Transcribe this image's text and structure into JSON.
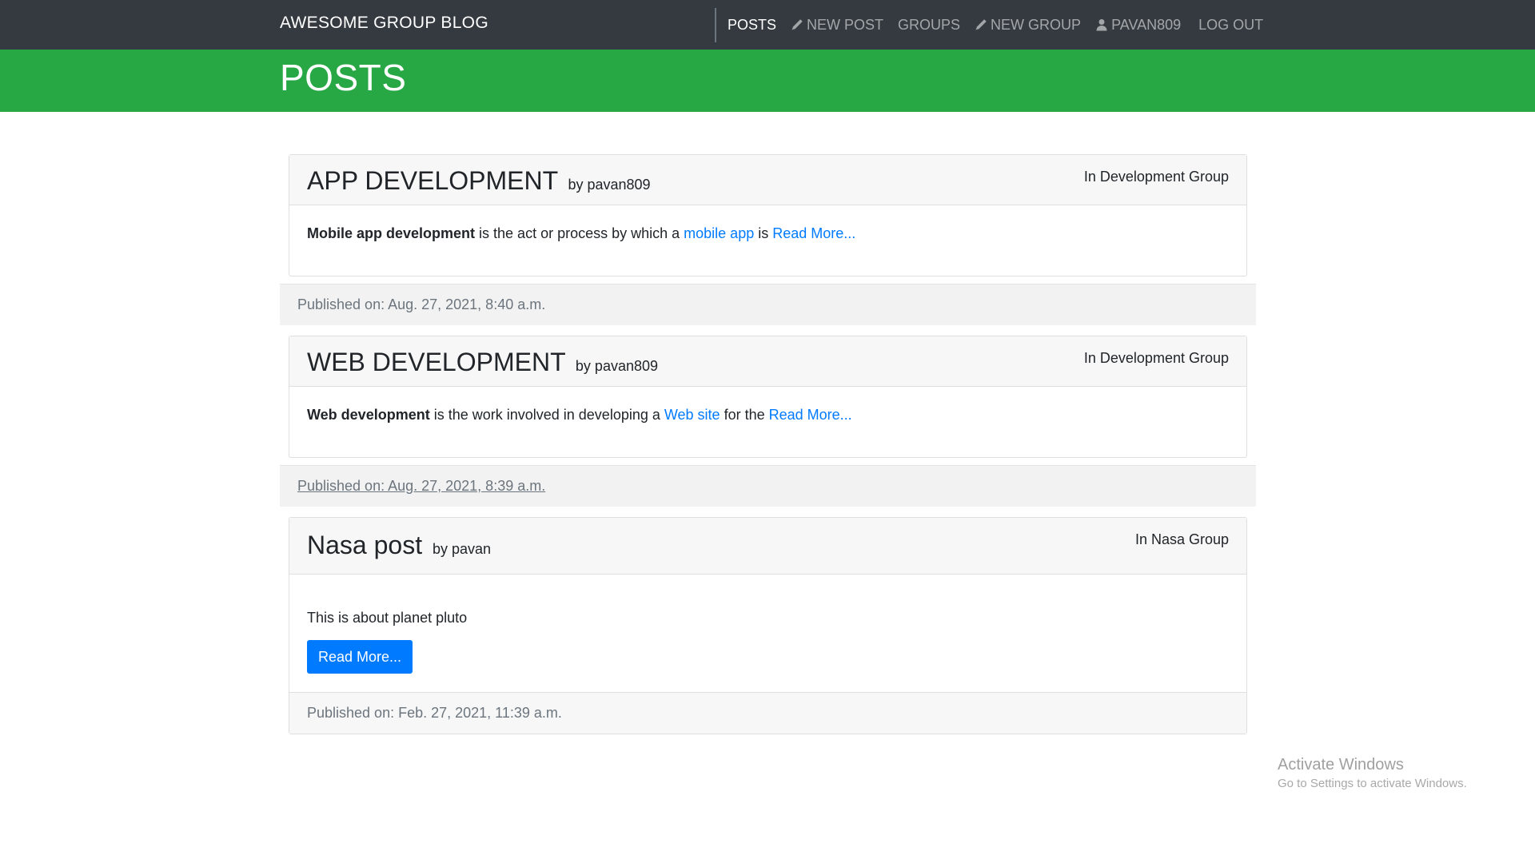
{
  "navbar": {
    "brand": "AWESOME GROUP BLOG",
    "links": [
      {
        "label": "POSTS",
        "icon": null,
        "active": true
      },
      {
        "label": "NEW POST",
        "icon": "pencil-icon",
        "active": false
      },
      {
        "label": "GROUPS",
        "icon": null,
        "active": false
      },
      {
        "label": "NEW GROUP",
        "icon": "pencil-icon",
        "active": false
      },
      {
        "label": "PAVAN809",
        "icon": "user-icon",
        "active": false
      },
      {
        "label": "LOG OUT",
        "icon": null,
        "active": false
      }
    ]
  },
  "page": {
    "title": "POSTS"
  },
  "posts": [
    {
      "title": "APP DEVELOPMENT",
      "author": "by pavan809",
      "group": "In Development Group",
      "body": {
        "bold": "Mobile app development",
        "text1": " is the act or process by which a ",
        "link": "mobile app",
        "text2": " is ",
        "read_more": "Read More..."
      },
      "published": "Published on: Aug. 27, 2021, 8:40 a.m."
    },
    {
      "title": "WEB DEVELOPMENT",
      "author": "by pavan809",
      "group": "In Development Group",
      "body": {
        "bold": "Web development",
        "text1": " is the work involved in developing a ",
        "link": "Web site",
        "text2": " for the ",
        "read_more": "Read More..."
      },
      "published": "Published on: Aug. 27, 2021, 8:39 a.m."
    },
    {
      "title": "Nasa post",
      "author": "by pavan",
      "group": "In Nasa Group",
      "body": {
        "text": "This is about planet pluto",
        "button": "Read More..."
      },
      "published": "Published on: Feb. 27, 2021, 11:39 a.m."
    }
  ],
  "watermark": {
    "title": "Activate Windows",
    "subtitle": "Go to Settings to activate Windows."
  },
  "colors": {
    "navbar": "#343a40",
    "jumbotron": "#28a745",
    "link": "#007bff",
    "button": "#007bff"
  }
}
